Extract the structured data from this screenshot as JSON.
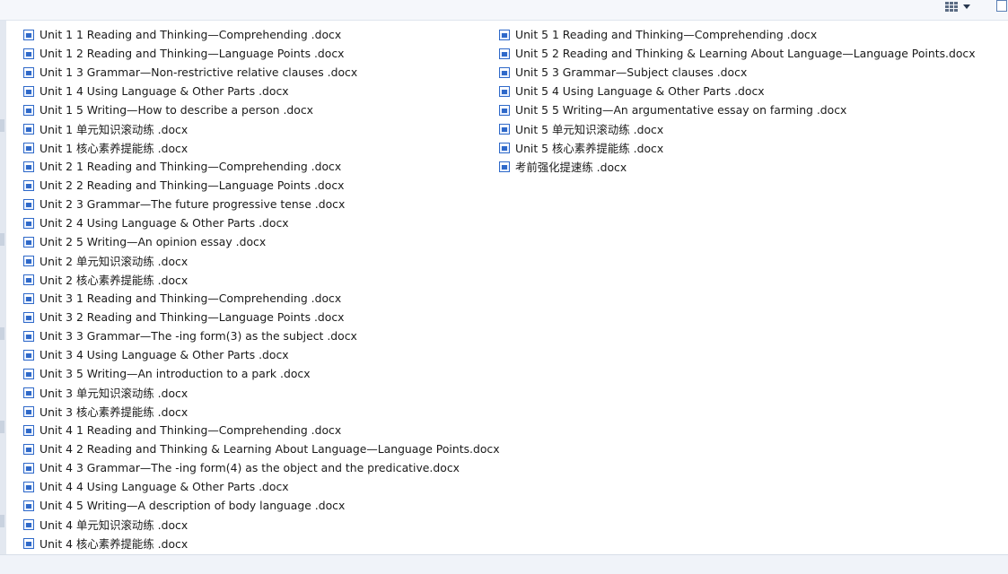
{
  "toolbar": {
    "view_icon": "details-grid-icon",
    "dropdown_icon": "chevron-down-icon",
    "pane_icon": "preview-pane-icon"
  },
  "files": {
    "left": [
      "Unit 1 1   Reading and Thinking—Comprehending  .docx",
      "Unit 1 2   Reading and Thinking—Language Points  .docx",
      "Unit 1 3   Grammar—Non-restrictive relative clauses  .docx",
      "Unit 1 4   Using Language & Other Parts  .docx",
      "Unit 1 5   Writing—How to describe a person  .docx",
      "Unit 1 单元知识滚动练  .docx",
      "Unit 1 核心素养提能练  .docx",
      "Unit 2 1   Reading and Thinking—Comprehending  .docx",
      "Unit 2 2   Reading and Thinking—Language Points  .docx",
      "Unit 2 3   Grammar—The future progressive tense  .docx",
      "Unit 2 4   Using Language & Other Parts  .docx",
      "Unit 2 5   Writing—An opinion essay  .docx",
      "Unit 2 单元知识滚动练  .docx",
      "Unit 2 核心素养提能练  .docx",
      "Unit 3 1   Reading and Thinking—Comprehending  .docx",
      "Unit 3 2   Reading and Thinking—Language Points  .docx",
      "Unit 3 3   Grammar—The -ing form(3) as the subject  .docx",
      "Unit 3 4   Using Language & Other Parts  .docx",
      "Unit 3 5   Writing—An introduction to a park  .docx",
      "Unit 3 单元知识滚动练  .docx",
      "Unit 3 核心素养提能练  .docx",
      "Unit 4 1   Reading and Thinking—Comprehending  .docx",
      "Unit 4 2   Reading and Thinking & Learning About Language—Language Points.docx",
      "Unit 4 3   Grammar—The -ing form(4) as the object and the predicative.docx",
      "Unit 4 4   Using Language & Other Parts  .docx",
      "Unit 4 5   Writing—A description of body language  .docx",
      "Unit 4 单元知识滚动练  .docx",
      "Unit 4 核心素养提能练  .docx"
    ],
    "right": [
      "Unit 5 1   Reading and Thinking—Comprehending  .docx",
      "Unit 5 2   Reading and Thinking & Learning About Language—Language Points.docx",
      "Unit 5 3   Grammar—Subject clauses  .docx",
      "Unit 5 4   Using Language & Other Parts  .docx",
      "Unit 5 5   Writing—An argumentative essay on farming  .docx",
      "Unit 5 单元知识滚动练  .docx",
      "Unit 5 核心素养提能练  .docx",
      "考前强化提速练  .docx"
    ]
  }
}
